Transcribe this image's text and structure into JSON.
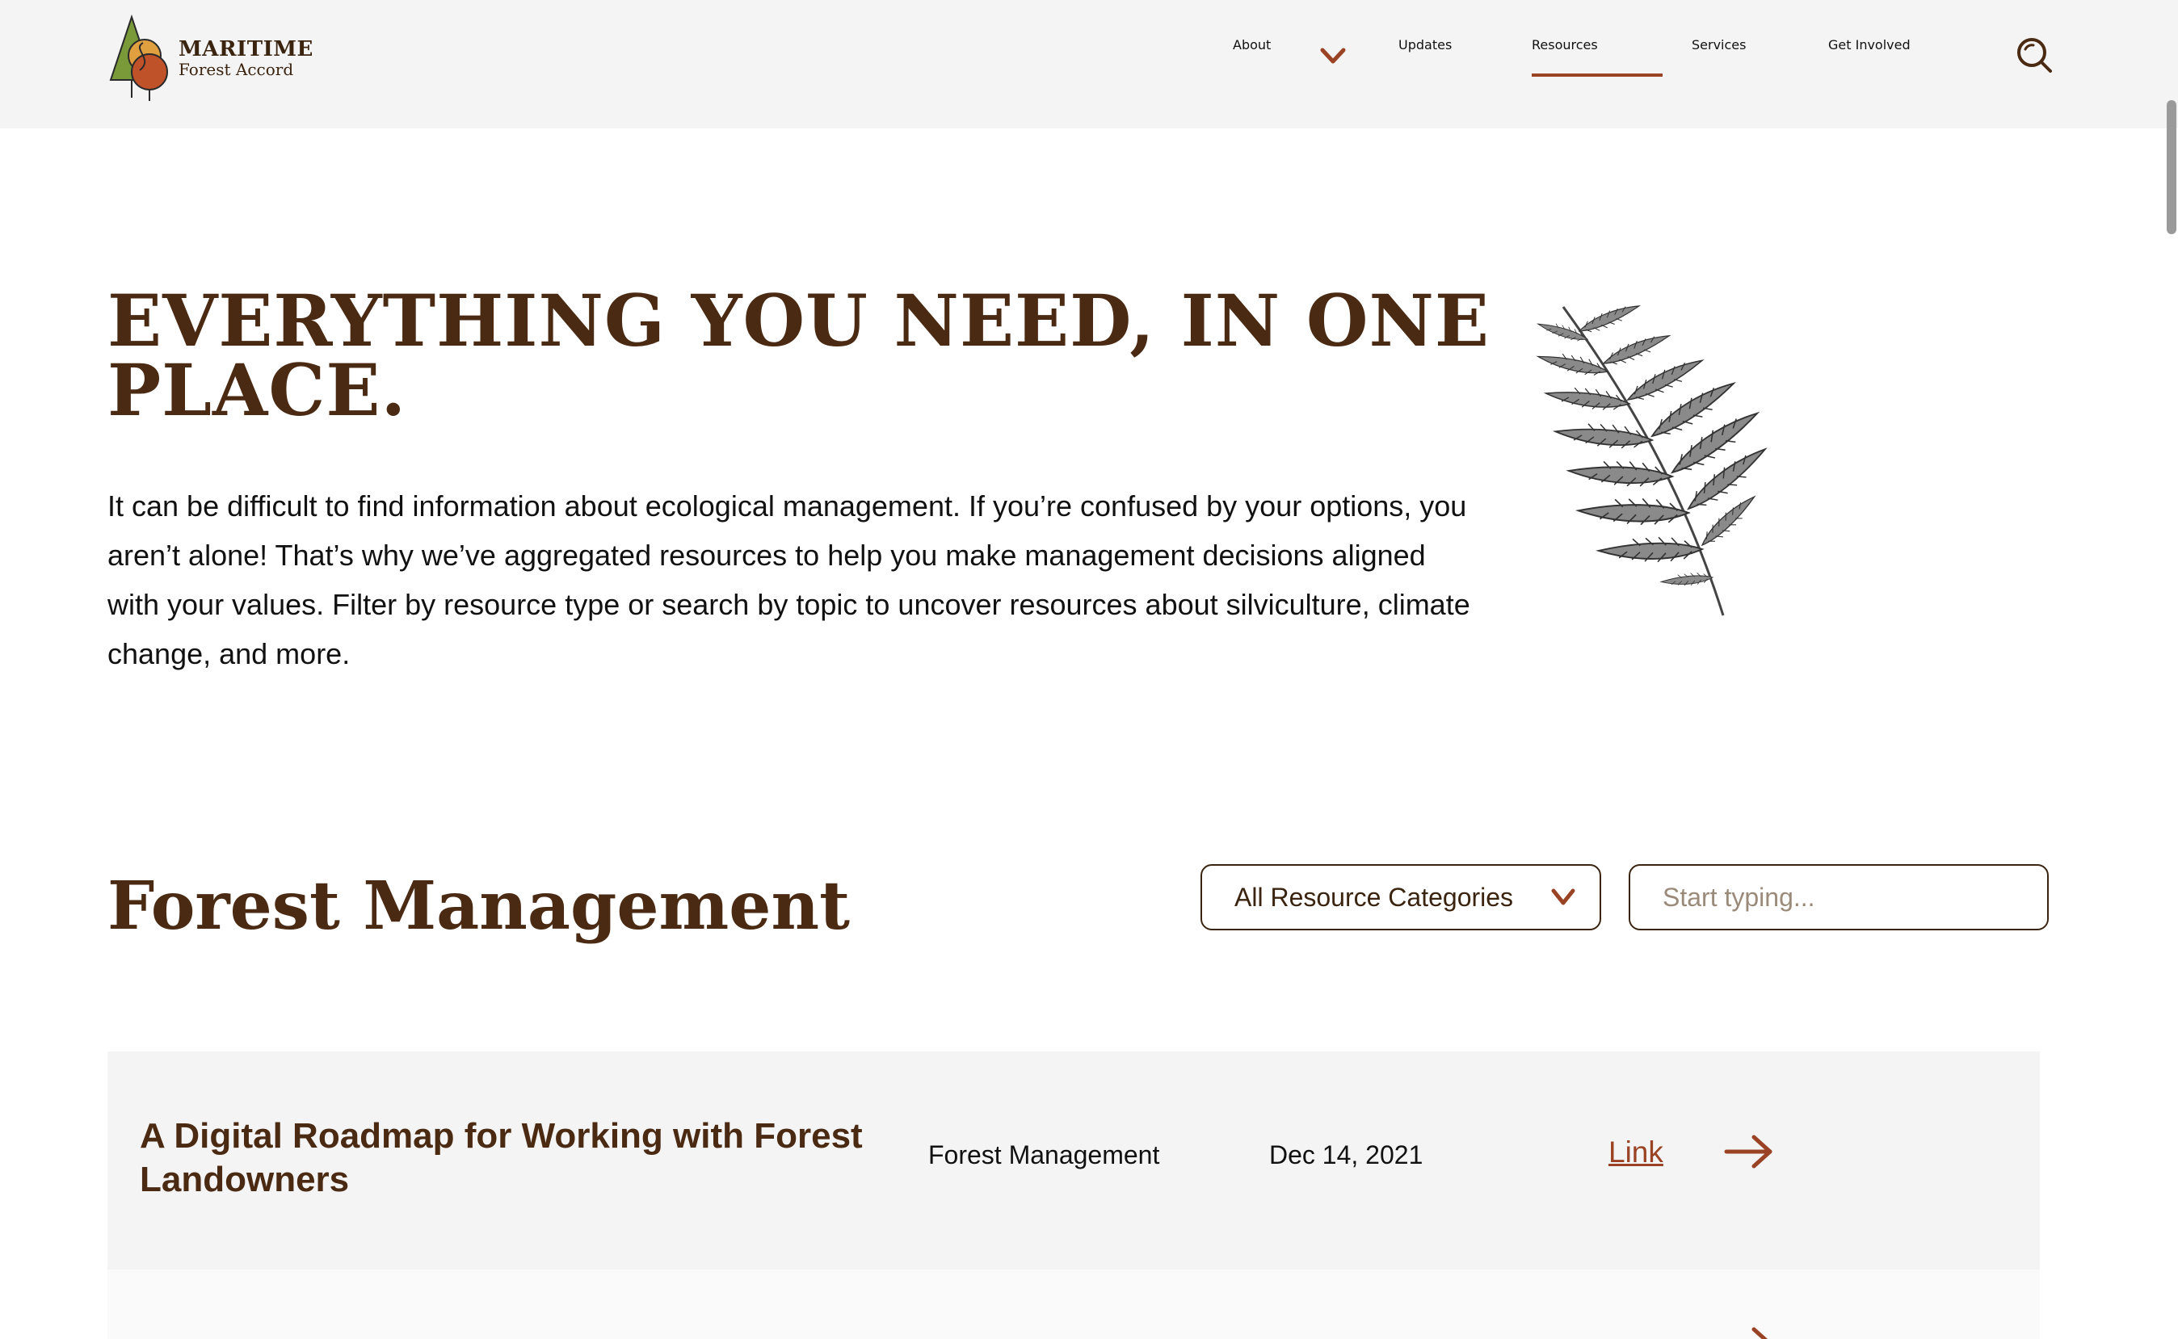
{
  "header": {
    "logo": {
      "line1": "MARITIME",
      "line2": "Forest Accord"
    },
    "nav": {
      "about": "About",
      "updates": "Updates",
      "resources": "Resources",
      "services": "Services",
      "get_involved": "Get Involved"
    },
    "active_nav": "Resources"
  },
  "hero": {
    "title": "EVERYTHING YOU NEED, IN ONE PLACE.",
    "body": "It can be difficult to find information about ecological management. If you’re confused by your options, you aren’t alone! That’s why we’ve aggregated resources to help you make management decisions aligned with your values. Filter by resource type or search by topic to uncover resources about silviculture, climate change, and more."
  },
  "section": {
    "title": "Forest Management",
    "category_select": "All Resource Categories",
    "search_placeholder": "Start typing..."
  },
  "resources": [
    {
      "title": "A Digital Roadmap for Working with Forest Landowners",
      "category": "Forest Management",
      "date": "Dec 14, 2021",
      "link_label": "Link "
    }
  ],
  "colors": {
    "brand_brown": "#4a2a12",
    "accent_rust": "#9a4324",
    "header_bg": "#f4f4f4",
    "row_bg": "#f4f4f4"
  }
}
